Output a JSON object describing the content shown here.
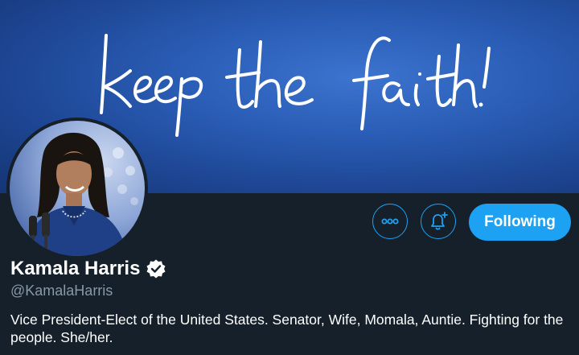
{
  "banner": {
    "script_text": "keep the faith!"
  },
  "profile": {
    "name": "Kamala Harris",
    "handle": "@KamalaHarris",
    "bio": "Vice President-Elect of the United States. Senator, Wife, Momala, Auntie. Fighting for the people. She/her.",
    "verified": true
  },
  "actions": {
    "more_icon": "more-horizontal-icon",
    "notify_icon": "bell-plus-icon",
    "follow_label": "Following"
  },
  "colors": {
    "accent": "#1da1f2",
    "background": "#15202b",
    "secondary_text": "#8899a6",
    "banner_blue": "#2a5db6"
  }
}
